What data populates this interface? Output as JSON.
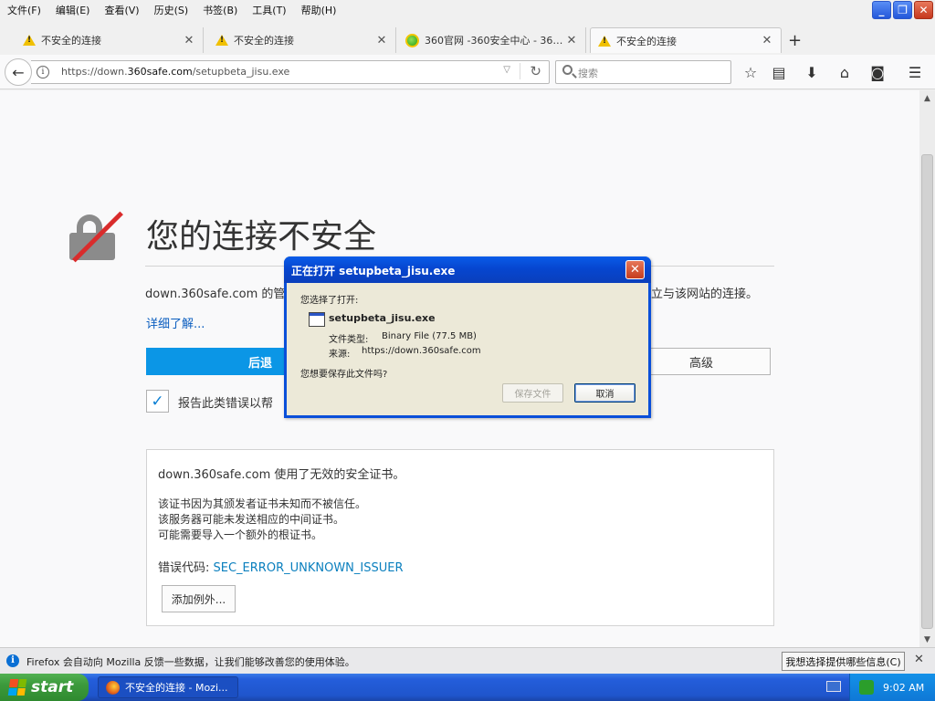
{
  "menu": [
    "文件(F)",
    "编辑(E)",
    "查看(V)",
    "历史(S)",
    "书签(B)",
    "工具(T)",
    "帮助(H)"
  ],
  "window_controls": {
    "minimize": "_",
    "restore": "❐",
    "close": "✕"
  },
  "tabs": [
    {
      "label": "不安全的连接",
      "icon": "warning-icon"
    },
    {
      "label": "不安全的连接",
      "icon": "warning-icon"
    },
    {
      "label": "360官网 -360安全中心 - 360...",
      "icon": "360-logo-icon"
    },
    {
      "label": "不安全的连接",
      "icon": "warning-icon",
      "active": true
    }
  ],
  "new_tab": "+",
  "urlbar": {
    "prefix": "https://down.",
    "domain": "360safe.com",
    "path": "/setupbeta_jisu.exe"
  },
  "search": {
    "placeholder": "搜索"
  },
  "page": {
    "title": "您的连接不安全",
    "desc_left": "down.360safe.com 的管",
    "desc_right": "立与该网站的连接。",
    "learn_more": "详细了解...",
    "go_back": "后退",
    "advanced": "高级",
    "report_label": "报告此类错误以帮",
    "details": {
      "line1": "down.360safe.com 使用了无效的安全证书。",
      "line2": "该证书因为其颁发者证书未知而不被信任。",
      "line3": "该服务器可能未发送相应的中间证书。",
      "line4": "可能需要导入一个额外的根证书。",
      "error_code_label": "错误代码: ",
      "error_code": "SEC_ERROR_UNKNOWN_ISSUER",
      "add_exception": "添加例外..."
    }
  },
  "dialog": {
    "title": "正在打开 setupbeta_jisu.exe",
    "prompt": "您选择了打开:",
    "filename": "setupbeta_jisu.exe",
    "filetype_label": "文件类型:",
    "filetype_value": "Binary File (77.5 MB)",
    "source_label": "来源:",
    "source_value": "https://down.360safe.com",
    "question": "您想要保存此文件吗?",
    "save": "保存文件",
    "cancel": "取消",
    "close": "✕"
  },
  "notification": {
    "text": "Firefox 会自动向 Mozilla 反馈一些数据，让我们能够改善您的使用体验。",
    "button": "我想选择提供哪些信息(C)",
    "close": "✕"
  },
  "taskbar": {
    "start": "start",
    "task": "不安全的连接 - Mozi...",
    "time": "9:02 AM"
  },
  "colors": {
    "accent": "#0b96e6",
    "link": "#0a5dbf",
    "title_bar": "#0a4fd9",
    "taskbar": "#245edb",
    "start": "#3c9a3c"
  }
}
